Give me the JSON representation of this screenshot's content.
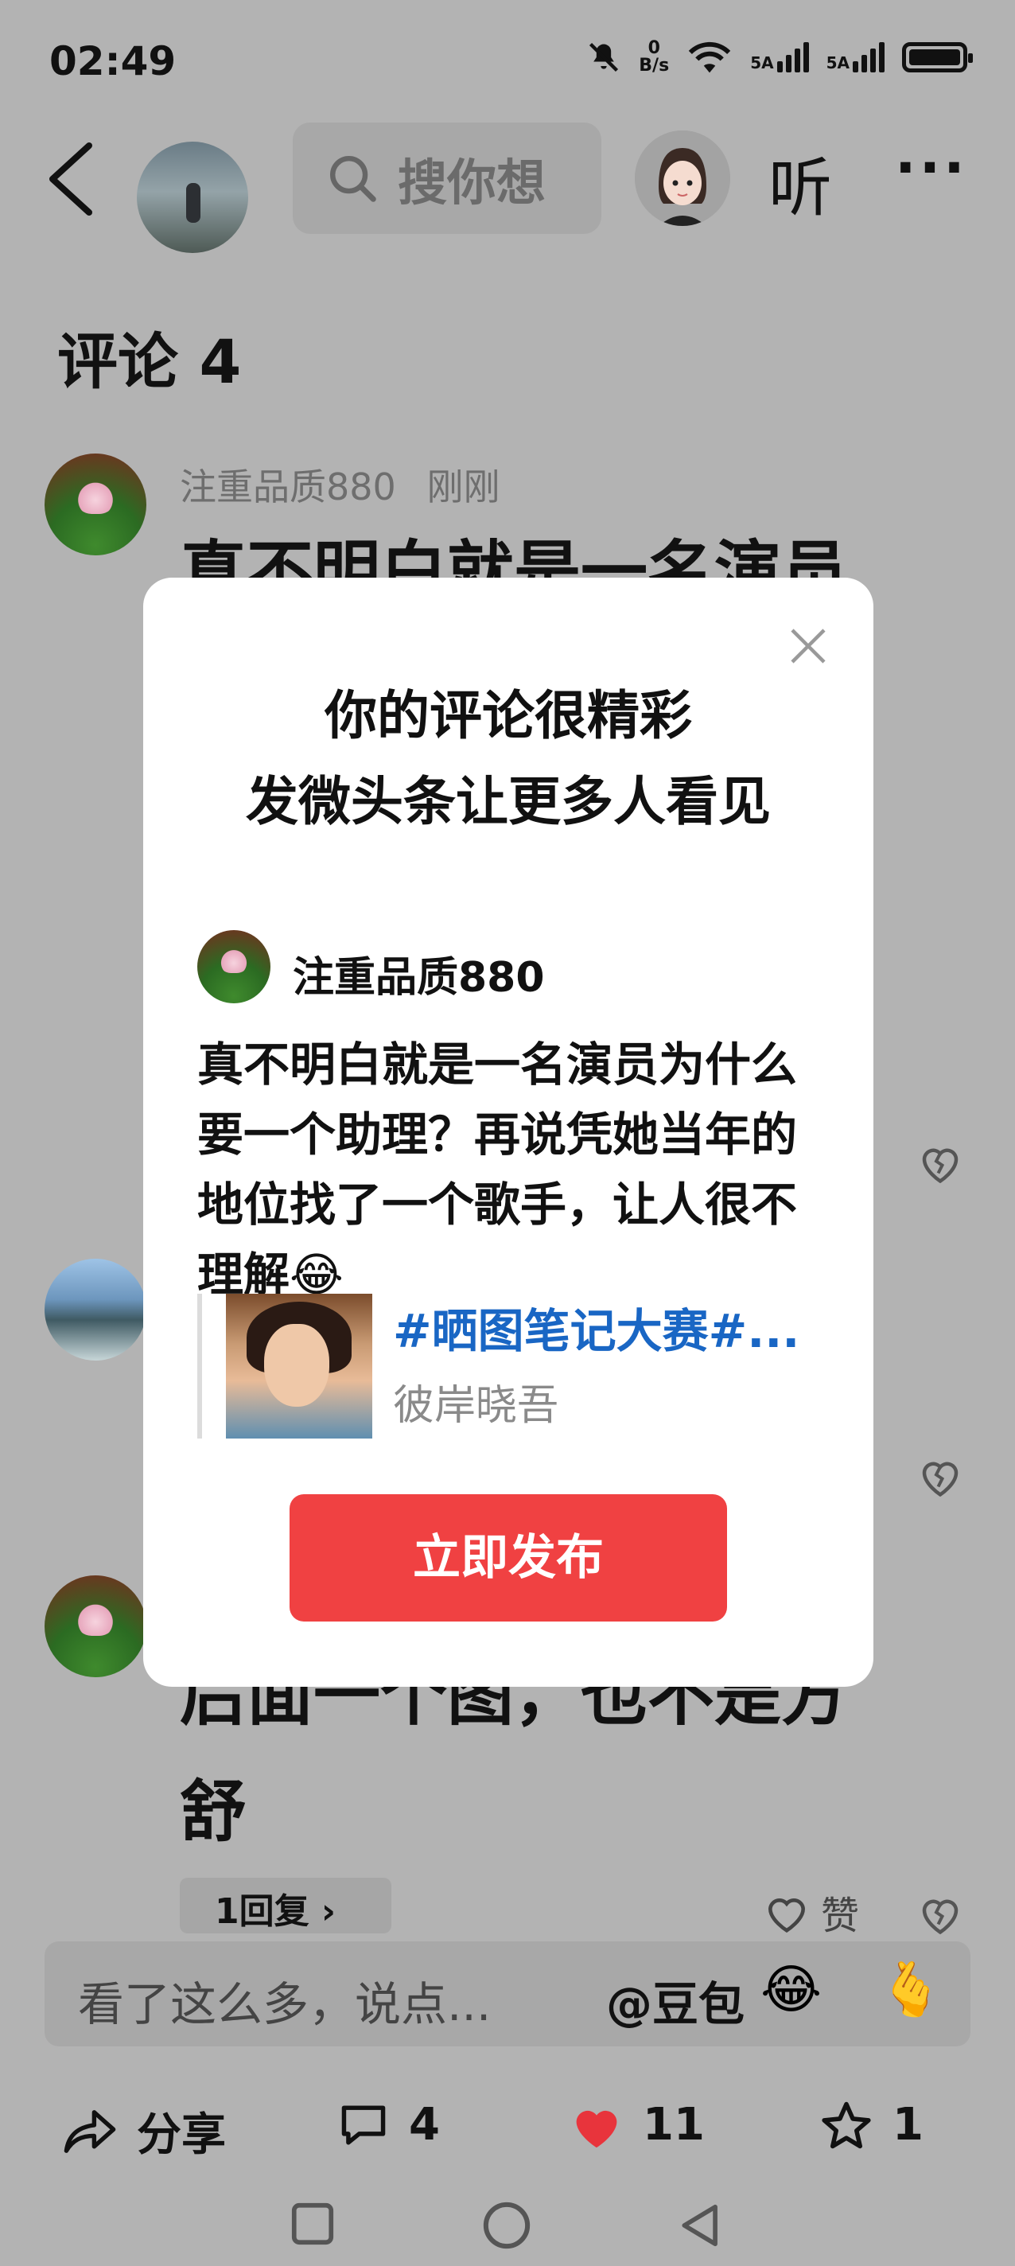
{
  "status_bar": {
    "time": "02:49",
    "net_speed_value": "0",
    "net_speed_unit": "B/s",
    "signal1_label": "5A",
    "signal2_label": "5A",
    "icons": [
      "mute-icon",
      "wifi-icon",
      "signal-icon",
      "battery-icon"
    ]
  },
  "topnav": {
    "search_placeholder": "搜你想",
    "listen_label": "听",
    "more_label": "···"
  },
  "comments": {
    "title": "评论 4",
    "first": {
      "username": "注重品质880",
      "time": "刚刚",
      "visible_line": "真不明白就是一名演员"
    },
    "third": {
      "line1": "后面一个图，也不是方",
      "line2": "舒",
      "reply_label": "1回复 ›",
      "like_label": "赞"
    }
  },
  "input_bar": {
    "placeholder": "看了这么多，说点...",
    "mention": "@豆包",
    "emoji1": "😂",
    "emoji2": "🫰"
  },
  "actions": {
    "share_label": "分享",
    "comment_count": "4",
    "like_count": "11",
    "favorite_count": "1"
  },
  "modal": {
    "heading1": "你的评论很精彩",
    "heading2": "发微头条让更多人看见",
    "username": "注重品质880",
    "comment_text": "真不明白就是一名演员为什么要一个助理？再说凭她当年的地位找了一个歌手，让人很不理解😂",
    "post_tag": "#晒图笔记大赛#...",
    "post_author": "彼岸晓吾",
    "publish_button": "立即发布"
  },
  "colors": {
    "dim_background": "#b3b3b3",
    "accent_red": "#f04142",
    "link_blue": "#1966c4"
  }
}
